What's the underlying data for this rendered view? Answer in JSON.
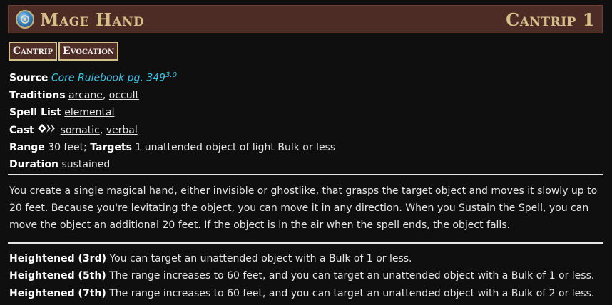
{
  "title": "Mage Hand",
  "level": "Cantrip 1",
  "traits": [
    "Cantrip",
    "Evocation"
  ],
  "source": {
    "label": "Source",
    "book": "Core Rulebook pg. 349",
    "version": "3.0"
  },
  "traditions": {
    "label": "Traditions",
    "items": [
      "arcane",
      "occult"
    ]
  },
  "spell_list": {
    "label": "Spell List",
    "value": "elemental"
  },
  "cast": {
    "label": "Cast",
    "actions_icon": "two-actions-icon",
    "components": [
      "somatic",
      "verbal"
    ]
  },
  "range": {
    "label": "Range",
    "value": "30 feet;"
  },
  "targets": {
    "label": "Targets",
    "value": "1 unattended object of light Bulk or less"
  },
  "duration": {
    "label": "Duration",
    "value": "sustained"
  },
  "description": "You create a single magical hand, either invisible or ghostlike, that grasps the target object and moves it slowly up to 20 feet. Because you're levitating the object, you can move it in any direction. When you Sustain the Spell, you can move the object an additional 20 feet. If the object is in the air when the spell ends, the object falls.",
  "heightened": [
    {
      "label": "Heightened (3rd)",
      "text": "You can target an unattended object with a Bulk of 1 or less."
    },
    {
      "label": "Heightened (5th)",
      "text": "The range increases to 60 feet, and you can target an unattended object with a Bulk of 1 or less."
    },
    {
      "label": "Heightened (7th)",
      "text": "The range increases to 60 feet, and you can target an unattended object with a Bulk of 2 or less."
    }
  ],
  "colors": {
    "title_bar": "#4e2c26",
    "title_text": "#d6c08a",
    "link": "#3cc7e8"
  }
}
